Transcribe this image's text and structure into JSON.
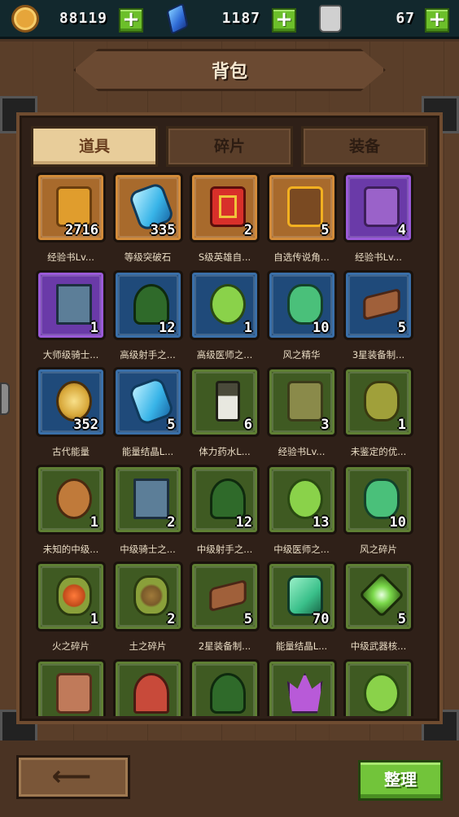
{
  "resources": [
    {
      "name": "gold",
      "icon": "gold-coin-icon",
      "value": "88119"
    },
    {
      "name": "gem",
      "icon": "blue-gem-icon",
      "value": "1187"
    },
    {
      "name": "potion",
      "icon": "stamina-bottle-icon",
      "value": "67"
    }
  ],
  "plus_label": "+",
  "title": "背包",
  "tabs": [
    {
      "label": "道具",
      "active": true
    },
    {
      "label": "碎片",
      "active": false
    },
    {
      "label": "装备",
      "active": false
    }
  ],
  "items": [
    {
      "name": "经验书Lv...",
      "count": "2716",
      "rarity": "orange",
      "icon": "book"
    },
    {
      "name": "等级突破石",
      "count": "335",
      "rarity": "orange",
      "icon": "crys"
    },
    {
      "name": "S级英雄自...",
      "count": "2",
      "rarity": "orange",
      "icon": "gift"
    },
    {
      "name": "自选传说角...",
      "count": "5",
      "rarity": "orange",
      "icon": "excl"
    },
    {
      "name": "经验书Lv...",
      "count": "4",
      "rarity": "purple",
      "icon": "bookp"
    },
    {
      "name": "大师级骑士...",
      "count": "1",
      "rarity": "purple",
      "icon": "tower"
    },
    {
      "name": "高级射手之...",
      "count": "12",
      "rarity": "blue",
      "icon": "bow"
    },
    {
      "name": "高级医师之...",
      "count": "1",
      "rarity": "blue",
      "icon": "pot"
    },
    {
      "name": "风之精华",
      "count": "10",
      "rarity": "blue",
      "icon": "wind"
    },
    {
      "name": "3星装备制...",
      "count": "5",
      "rarity": "blue",
      "icon": "plank"
    },
    {
      "name": "古代能量",
      "count": "352",
      "rarity": "blue",
      "icon": "orb"
    },
    {
      "name": "能量结晶L...",
      "count": "5",
      "rarity": "blue",
      "icon": "crys"
    },
    {
      "name": "体力药水L...",
      "count": "6",
      "rarity": "green",
      "icon": "flask"
    },
    {
      "name": "经验书Lv...",
      "count": "3",
      "rarity": "green",
      "icon": "bookg"
    },
    {
      "name": "未鉴定的优...",
      "count": "1",
      "rarity": "green",
      "icon": "mys"
    },
    {
      "name": "未知的中级...",
      "count": "1",
      "rarity": "green",
      "icon": "mysc"
    },
    {
      "name": "中级骑士之...",
      "count": "2",
      "rarity": "green",
      "icon": "tower"
    },
    {
      "name": "中级射手之...",
      "count": "12",
      "rarity": "green",
      "icon": "bow"
    },
    {
      "name": "中级医师之...",
      "count": "13",
      "rarity": "green",
      "icon": "pot"
    },
    {
      "name": "风之碎片",
      "count": "10",
      "rarity": "green",
      "icon": "wind"
    },
    {
      "name": "火之碎片",
      "count": "1",
      "rarity": "green",
      "icon": "fire"
    },
    {
      "name": "土之碎片",
      "count": "2",
      "rarity": "green",
      "icon": "earth"
    },
    {
      "name": "2星装备制...",
      "count": "5",
      "rarity": "green",
      "icon": "plank"
    },
    {
      "name": "能量结晶L...",
      "count": "70",
      "rarity": "green",
      "icon": "gemg"
    },
    {
      "name": "中级武器核...",
      "count": "5",
      "rarity": "green",
      "icon": "core"
    },
    {
      "name": "",
      "count": "",
      "rarity": "green",
      "icon": "bookb"
    },
    {
      "name": "",
      "count": "",
      "rarity": "green",
      "icon": "sword"
    },
    {
      "name": "",
      "count": "",
      "rarity": "green",
      "icon": "bow"
    },
    {
      "name": "",
      "count": "",
      "rarity": "green",
      "icon": "lotus"
    },
    {
      "name": "",
      "count": "",
      "rarity": "green",
      "icon": "pot"
    }
  ],
  "back_label": "⟵",
  "sort_label": "整理"
}
